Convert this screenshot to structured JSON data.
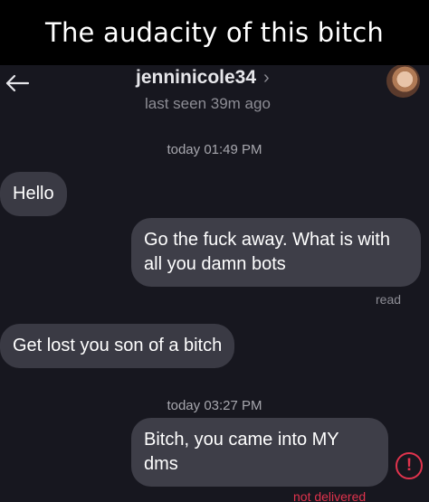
{
  "meme_caption": "The audacity of this bitch",
  "header": {
    "username": "jenninicole34",
    "chevron": "›",
    "last_seen": "last seen 39m ago",
    "back_icon": "arrow-left-icon",
    "avatar": "profile-avatar"
  },
  "thread": {
    "day_label_1": "today 01:49 PM",
    "msg_1": "Hello",
    "msg_2": "Go the fuck away. What is with all you damn bots",
    "status_2": "read",
    "msg_3": "Get lost you son of a bitch",
    "day_label_2": "today 03:27 PM",
    "msg_4": "Bitch, you came into MY dms",
    "status_4": "not delivered",
    "error_icon": "!"
  },
  "colors": {
    "background": "#17171f",
    "incoming_bubble": "#3a3a44",
    "outgoing_bubble": "#3e3e48",
    "error": "#e0334d"
  }
}
